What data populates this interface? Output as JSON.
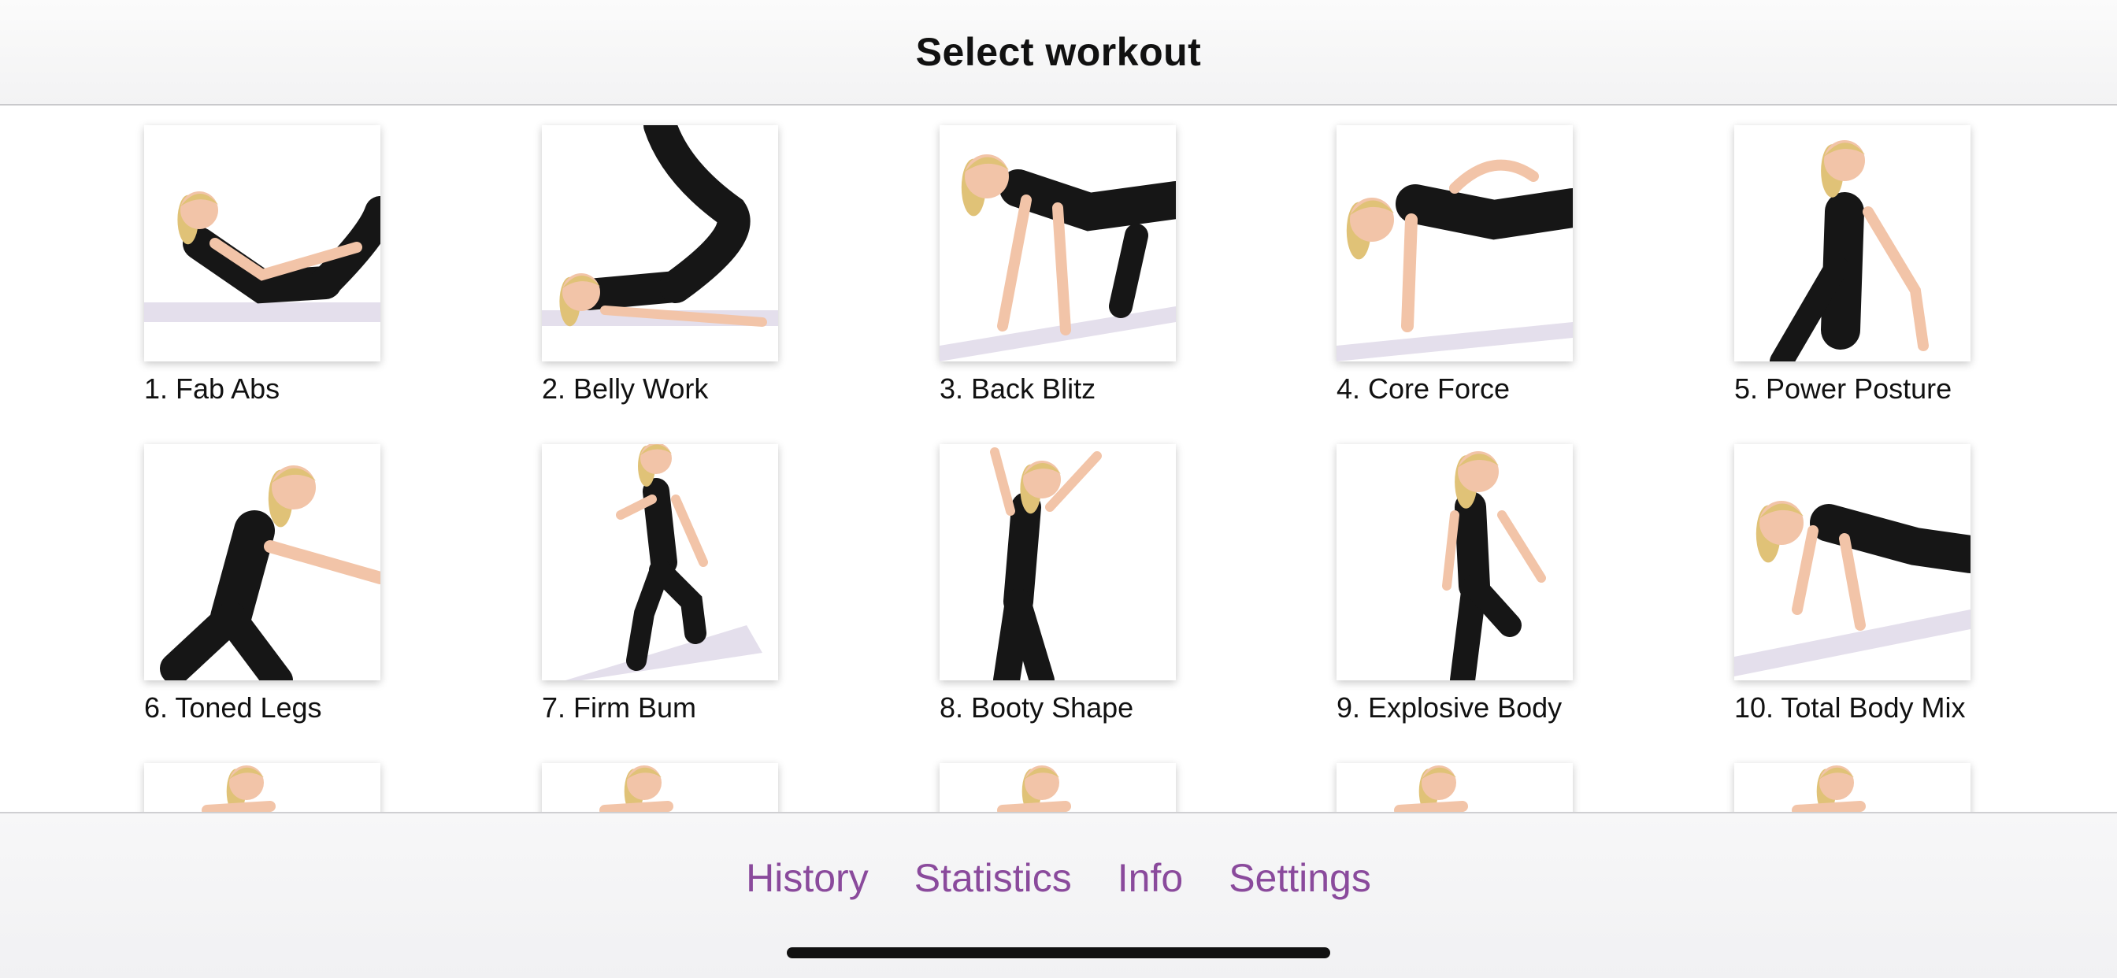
{
  "header": {
    "title": "Select workout"
  },
  "workouts": [
    {
      "label": "1. Fab Abs",
      "pose": "crunch"
    },
    {
      "label": "2. Belly Work",
      "pose": "legs-up"
    },
    {
      "label": "3. Back Blitz",
      "pose": "all-fours"
    },
    {
      "label": "4. Core Force",
      "pose": "side-plank"
    },
    {
      "label": "5. Power Posture",
      "pose": "standing"
    },
    {
      "label": "6. Toned Legs",
      "pose": "squat"
    },
    {
      "label": "7. Firm Bum",
      "pose": "lunge"
    },
    {
      "label": "8. Booty Shape",
      "pose": "arms-up"
    },
    {
      "label": "9. Explosive Body",
      "pose": "run"
    },
    {
      "label": "10. Total Body Mix",
      "pose": "pushup"
    },
    {
      "label": "",
      "pose": "partial"
    },
    {
      "label": "",
      "pose": "partial"
    },
    {
      "label": "",
      "pose": "partial"
    },
    {
      "label": "",
      "pose": "partial"
    },
    {
      "label": "",
      "pose": "partial"
    }
  ],
  "tabbar": {
    "history": "History",
    "statistics": "Statistics",
    "info": "Info",
    "settings": "Settings"
  },
  "colors": {
    "accent": "#8a4a9c",
    "outfit": "#161616",
    "skin": "#f2c4a8",
    "hair": "#e0c277",
    "mat": "#e4dfec"
  }
}
